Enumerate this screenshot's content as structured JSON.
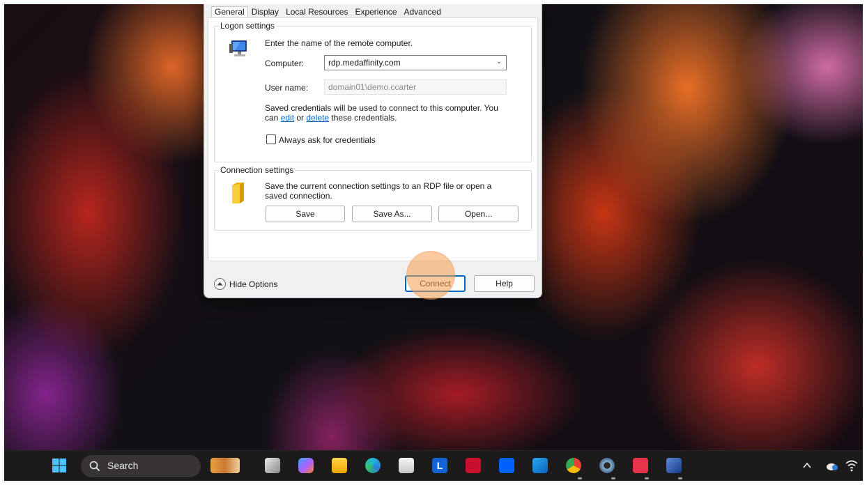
{
  "dialog": {
    "tabs": [
      "General",
      "Display",
      "Local Resources",
      "Experience",
      "Advanced"
    ],
    "active_tab": "General",
    "logon": {
      "title": "Logon settings",
      "instruction": "Enter the name of the remote computer.",
      "computer_label": "Computer:",
      "computer_value": "rdp.medaffinity.com",
      "username_label": "User name:",
      "username_value": "domain01\\demo.ccarter",
      "saved_line1": "Saved credentials will be used to connect to this computer.  You",
      "saved_can": "can ",
      "edit_link": "edit",
      "or": " or ",
      "delete_link": "delete",
      "saved_tail": " these credentials.",
      "always_ask": "Always ask for credentials",
      "always_ask_checked": false
    },
    "connection": {
      "title": "Connection settings",
      "desc_line1": "Save the current connection settings to an RDP file or open a",
      "desc_line2": "saved connection.",
      "save": "Save",
      "save_as": "Save As...",
      "open": "Open..."
    },
    "hide_options": "Hide Options",
    "connect": "Connect",
    "help": "Help"
  },
  "taskbar": {
    "search_label": "Search",
    "icons": [
      "windows-start-icon",
      "widgets-icon",
      "task-view-icon",
      "copilot-icon",
      "file-explorer-icon",
      "edge-icon",
      "store-icon",
      "l-app-icon",
      "mcafee-icon",
      "dropbox-icon",
      "outlook-icon",
      "chrome-icon",
      "settings-icon",
      "snagit-icon",
      "remote-desktop-icon"
    ],
    "tray_icons": [
      "chevron-up-icon",
      "onedrive-icon",
      "wifi-icon"
    ]
  },
  "colors": {
    "accent": "#0067c0",
    "link": "#0066cc",
    "highlight": "#f5a050"
  }
}
